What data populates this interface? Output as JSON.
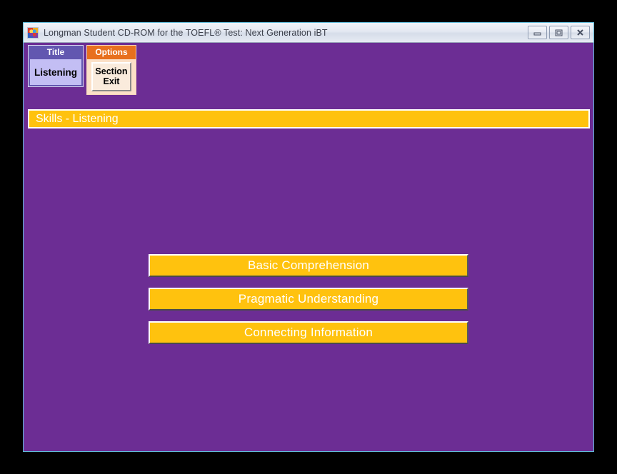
{
  "window": {
    "title": "Longman Student CD-ROM for the TOEFL® Test: Next Generation iBT",
    "app_icon": "puzzle-icon",
    "controls": [
      {
        "name": "minimize-button",
        "icon": "minimize-icon"
      },
      {
        "name": "maximize-button",
        "icon": "maximize-icon"
      },
      {
        "name": "close-button",
        "icon": "close-icon"
      }
    ]
  },
  "panels": {
    "title_panel": {
      "header": "Title",
      "value": "Listening"
    },
    "options_panel": {
      "header": "Options",
      "button_line1": "Section",
      "button_line2": "Exit",
      "button_label": "Section Exit"
    }
  },
  "banner": {
    "text": "Skills - Listening"
  },
  "skills": [
    {
      "label": "Basic Comprehension"
    },
    {
      "label": "Pragmatic Understanding"
    },
    {
      "label": "Connecting Information"
    }
  ],
  "colors": {
    "purple_background": "#6C2D94",
    "amber": "#ffc20e",
    "orange_header": "#e8701e",
    "slate_purple_header": "#6257b0",
    "lavender_body": "#c3bef4",
    "cream_button": "#faebdc",
    "frame_border": "#62bddb"
  }
}
